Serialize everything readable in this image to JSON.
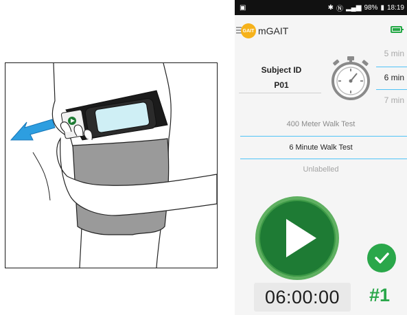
{
  "statusbar": {
    "signal_text": "98%",
    "time": "18:19"
  },
  "app": {
    "title": "mGAIT",
    "logo_text": "GAIT"
  },
  "subject": {
    "label": "Subject ID",
    "value": "P01"
  },
  "duration_picker": {
    "options": [
      "5 min",
      "6 min",
      "7 min"
    ],
    "selected": "6 min"
  },
  "test_picker": {
    "options": [
      "400 Meter Walk Test",
      "6 Minute Walk Test",
      "Unlabelled"
    ],
    "selected": "6 Minute Walk Test"
  },
  "timer": {
    "value": "06:00:00"
  },
  "run": {
    "number": "#1"
  },
  "colors": {
    "accent_green": "#2aa74a",
    "play_green": "#1e7b34",
    "divider_blue": "#4fc3f7",
    "arrow_blue": "#2d9ee0"
  }
}
